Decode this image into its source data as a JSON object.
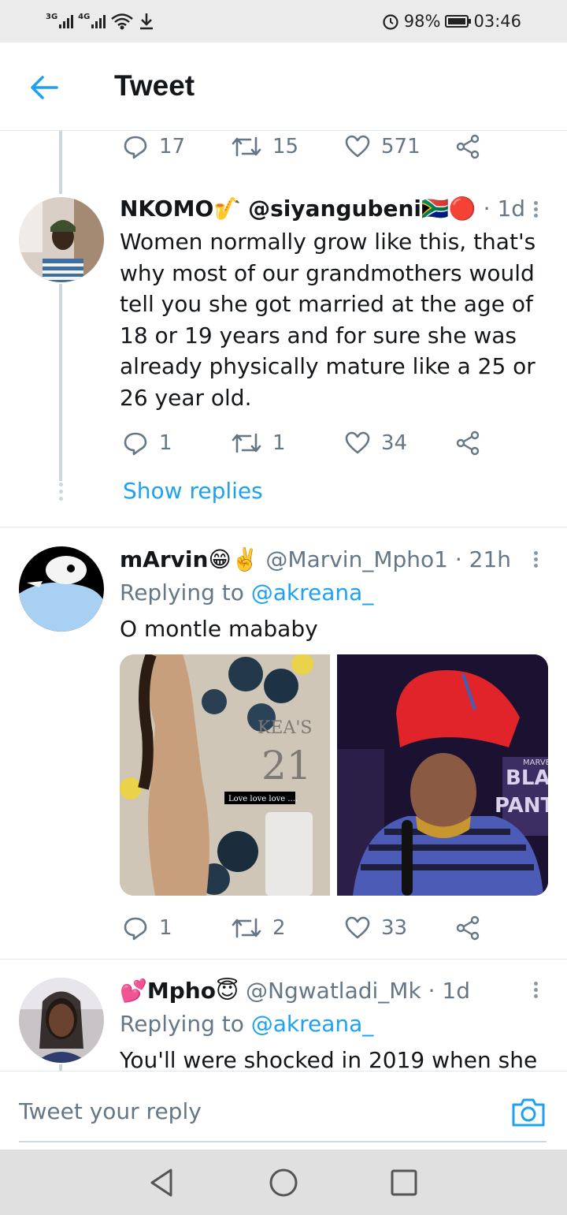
{
  "status_bar": {
    "signal1_label": "3G",
    "signal2_label": "4G",
    "battery_percent": "98%",
    "battery_level": 0.98,
    "time": "03:46"
  },
  "header": {
    "title": "Tweet"
  },
  "prev_tweet_actions": {
    "replies": "17",
    "retweets": "15",
    "likes": "571"
  },
  "tweets": [
    {
      "name": "NKOMO🎷",
      "handle": "@siyangubeni🇿🇦🔴",
      "time": "· 1d",
      "text": "Women normally grow like this, that's why most of our grandmothers would tell you she got married at the age of 18 or 19 years and for sure she was already physically mature like a 25 or 26 year old.",
      "replies": "1",
      "retweets": "1",
      "likes": "34",
      "show_replies": "Show replies"
    },
    {
      "name": "mArvin😁✌️",
      "handle": "@Marvin_Mpho1",
      "time": "· 21h",
      "replying_prefix": "Replying to ",
      "replying_handle": "@akreana_",
      "text": "O montle mababy",
      "media_left_caption": "Love love love ....",
      "media_left_sign_top": "KEA'S",
      "media_left_sign_num": "21",
      "media_right_caption_top": "MARVEL S",
      "media_right_caption_mid": "BLA",
      "media_right_caption_low": "PANTI",
      "replies": "1",
      "retweets": "2",
      "likes": "33"
    },
    {
      "name": "Mpho😇",
      "handle": "@Ngwatladi_Mk",
      "time": "· 1d",
      "name_prefix": "💕",
      "replying_prefix": "Replying to ",
      "replying_handle": "@akreana_",
      "text": "You'll were shocked in 2019 when she"
    }
  ],
  "reply_bar": {
    "placeholder": "Tweet your reply"
  },
  "colors": {
    "accent": "#1da1f2",
    "muted": "#657786",
    "divider": "#e1e8ed"
  }
}
